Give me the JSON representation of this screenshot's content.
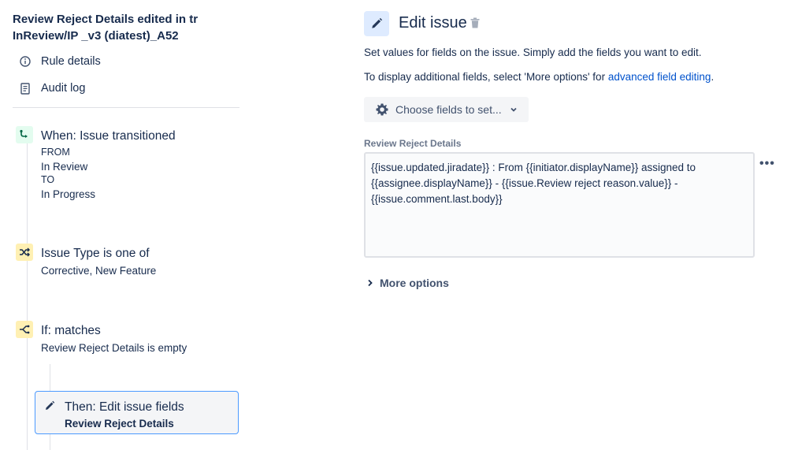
{
  "rule": {
    "title_line1": "Review Reject Details edited in tr",
    "title_line2": "InReview/IP _v3 (diatest)_A52"
  },
  "nav": {
    "rule_details": "Rule details",
    "audit_log": "Audit log"
  },
  "steps": {
    "trigger": {
      "title": "When: Issue transitioned",
      "from_label": "FROM",
      "from_value": "In Review",
      "to_label": "TO",
      "to_value": "In Progress"
    },
    "condition": {
      "title": "Issue Type is one of",
      "value": "Corrective, New Feature"
    },
    "if_block": {
      "title": "If: matches",
      "value": "Review Reject Details is empty"
    },
    "action": {
      "title": "Then: Edit issue fields",
      "value": "Review Reject Details"
    }
  },
  "editor": {
    "title": "Edit issue",
    "desc1": "Set values for fields on the issue. Simply add the fields you want to edit.",
    "desc2_prefix": "To display additional fields, select 'More options' for ",
    "desc2_link": "advanced field editing",
    "desc2_suffix": ".",
    "choose_fields": "Choose fields to set...",
    "field_label": "Review Reject Details",
    "field_value_line1": "{{issue.updated.jiradate}} : From {{initiator.displayName}} assigned to",
    "field_value_line2": "{{assignee.displayName}} - {{issue.Review reject reason.value}} -",
    "field_value_line3": "{{issue.comment.last.body}}",
    "more_options": "More options",
    "field_menu": "•••"
  },
  "colors": {
    "accent_blue": "#0052cc",
    "selected_border": "#4c9aff",
    "trigger_green": "#36b37e",
    "condition_yellow": "#fff0b3"
  }
}
